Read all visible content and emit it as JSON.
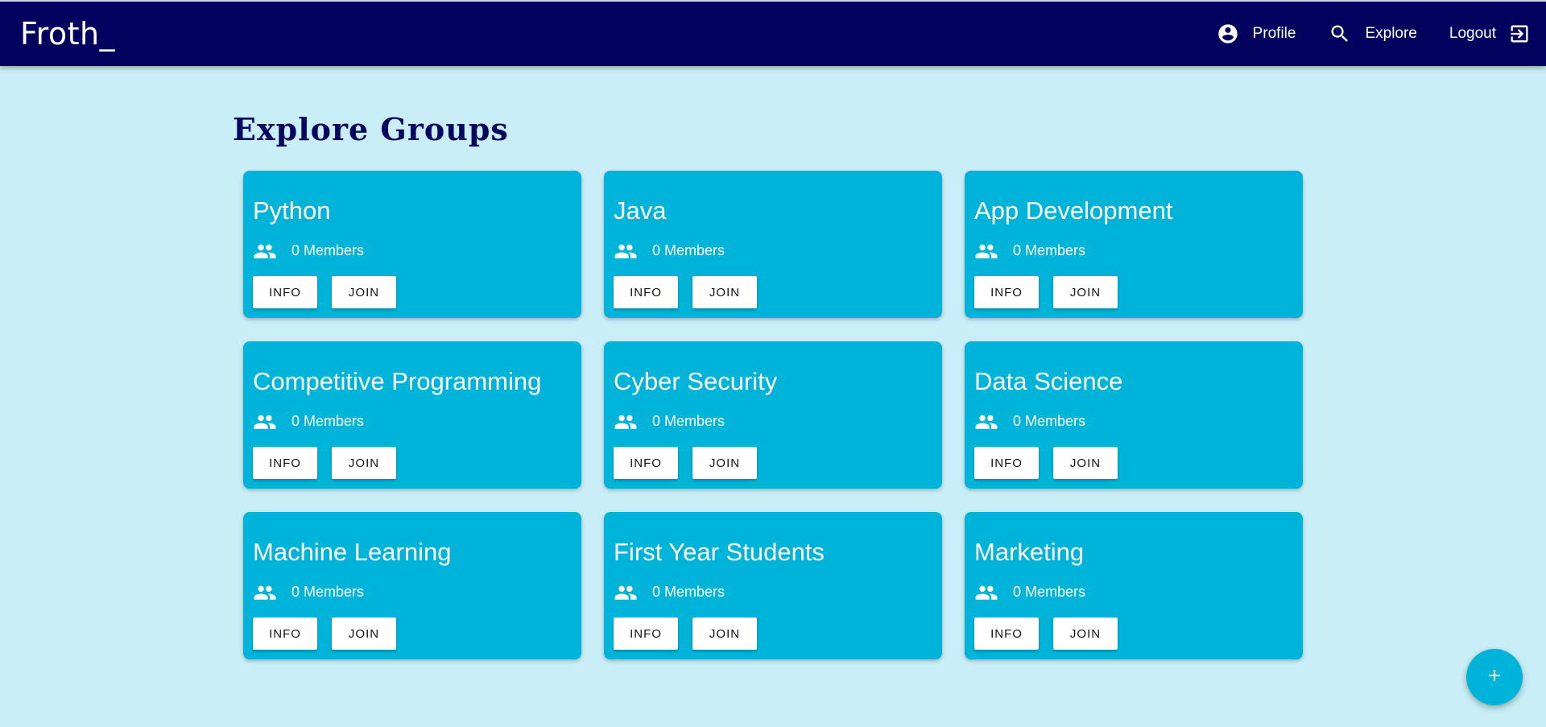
{
  "header": {
    "brand": "Froth_",
    "nav": [
      {
        "label": "Profile",
        "icon": "account-circle-icon"
      },
      {
        "label": "Explore",
        "icon": "search-icon"
      },
      {
        "label": "Logout",
        "icon": "logout-icon"
      }
    ]
  },
  "main": {
    "title": "Explore Groups",
    "groups": [
      {
        "name": "Python",
        "members": "0 Members",
        "info_label": "INFO",
        "join_label": "JOIN"
      },
      {
        "name": "Java",
        "members": "0 Members",
        "info_label": "INFO",
        "join_label": "JOIN"
      },
      {
        "name": "App Development",
        "members": "0 Members",
        "info_label": "INFO",
        "join_label": "JOIN"
      },
      {
        "name": "Competitive Programming",
        "members": "0 Members",
        "info_label": "INFO",
        "join_label": "JOIN"
      },
      {
        "name": "Cyber Security",
        "members": "0 Members",
        "info_label": "INFO",
        "join_label": "JOIN"
      },
      {
        "name": "Data Science",
        "members": "0 Members",
        "info_label": "INFO",
        "join_label": "JOIN"
      },
      {
        "name": "Machine Learning",
        "members": "0 Members",
        "info_label": "INFO",
        "join_label": "JOIN"
      },
      {
        "name": "First Year Students",
        "members": "0 Members",
        "info_label": "INFO",
        "join_label": "JOIN"
      },
      {
        "name": "Marketing",
        "members": "0 Members",
        "info_label": "INFO",
        "join_label": "JOIN"
      }
    ]
  },
  "fab": {
    "label": "+",
    "icon": "add-icon"
  },
  "colors": {
    "navbar": "#03035f",
    "background": "#c9eef7",
    "card": "#00b4d9",
    "title": "#070760",
    "button": "#ffffff"
  }
}
